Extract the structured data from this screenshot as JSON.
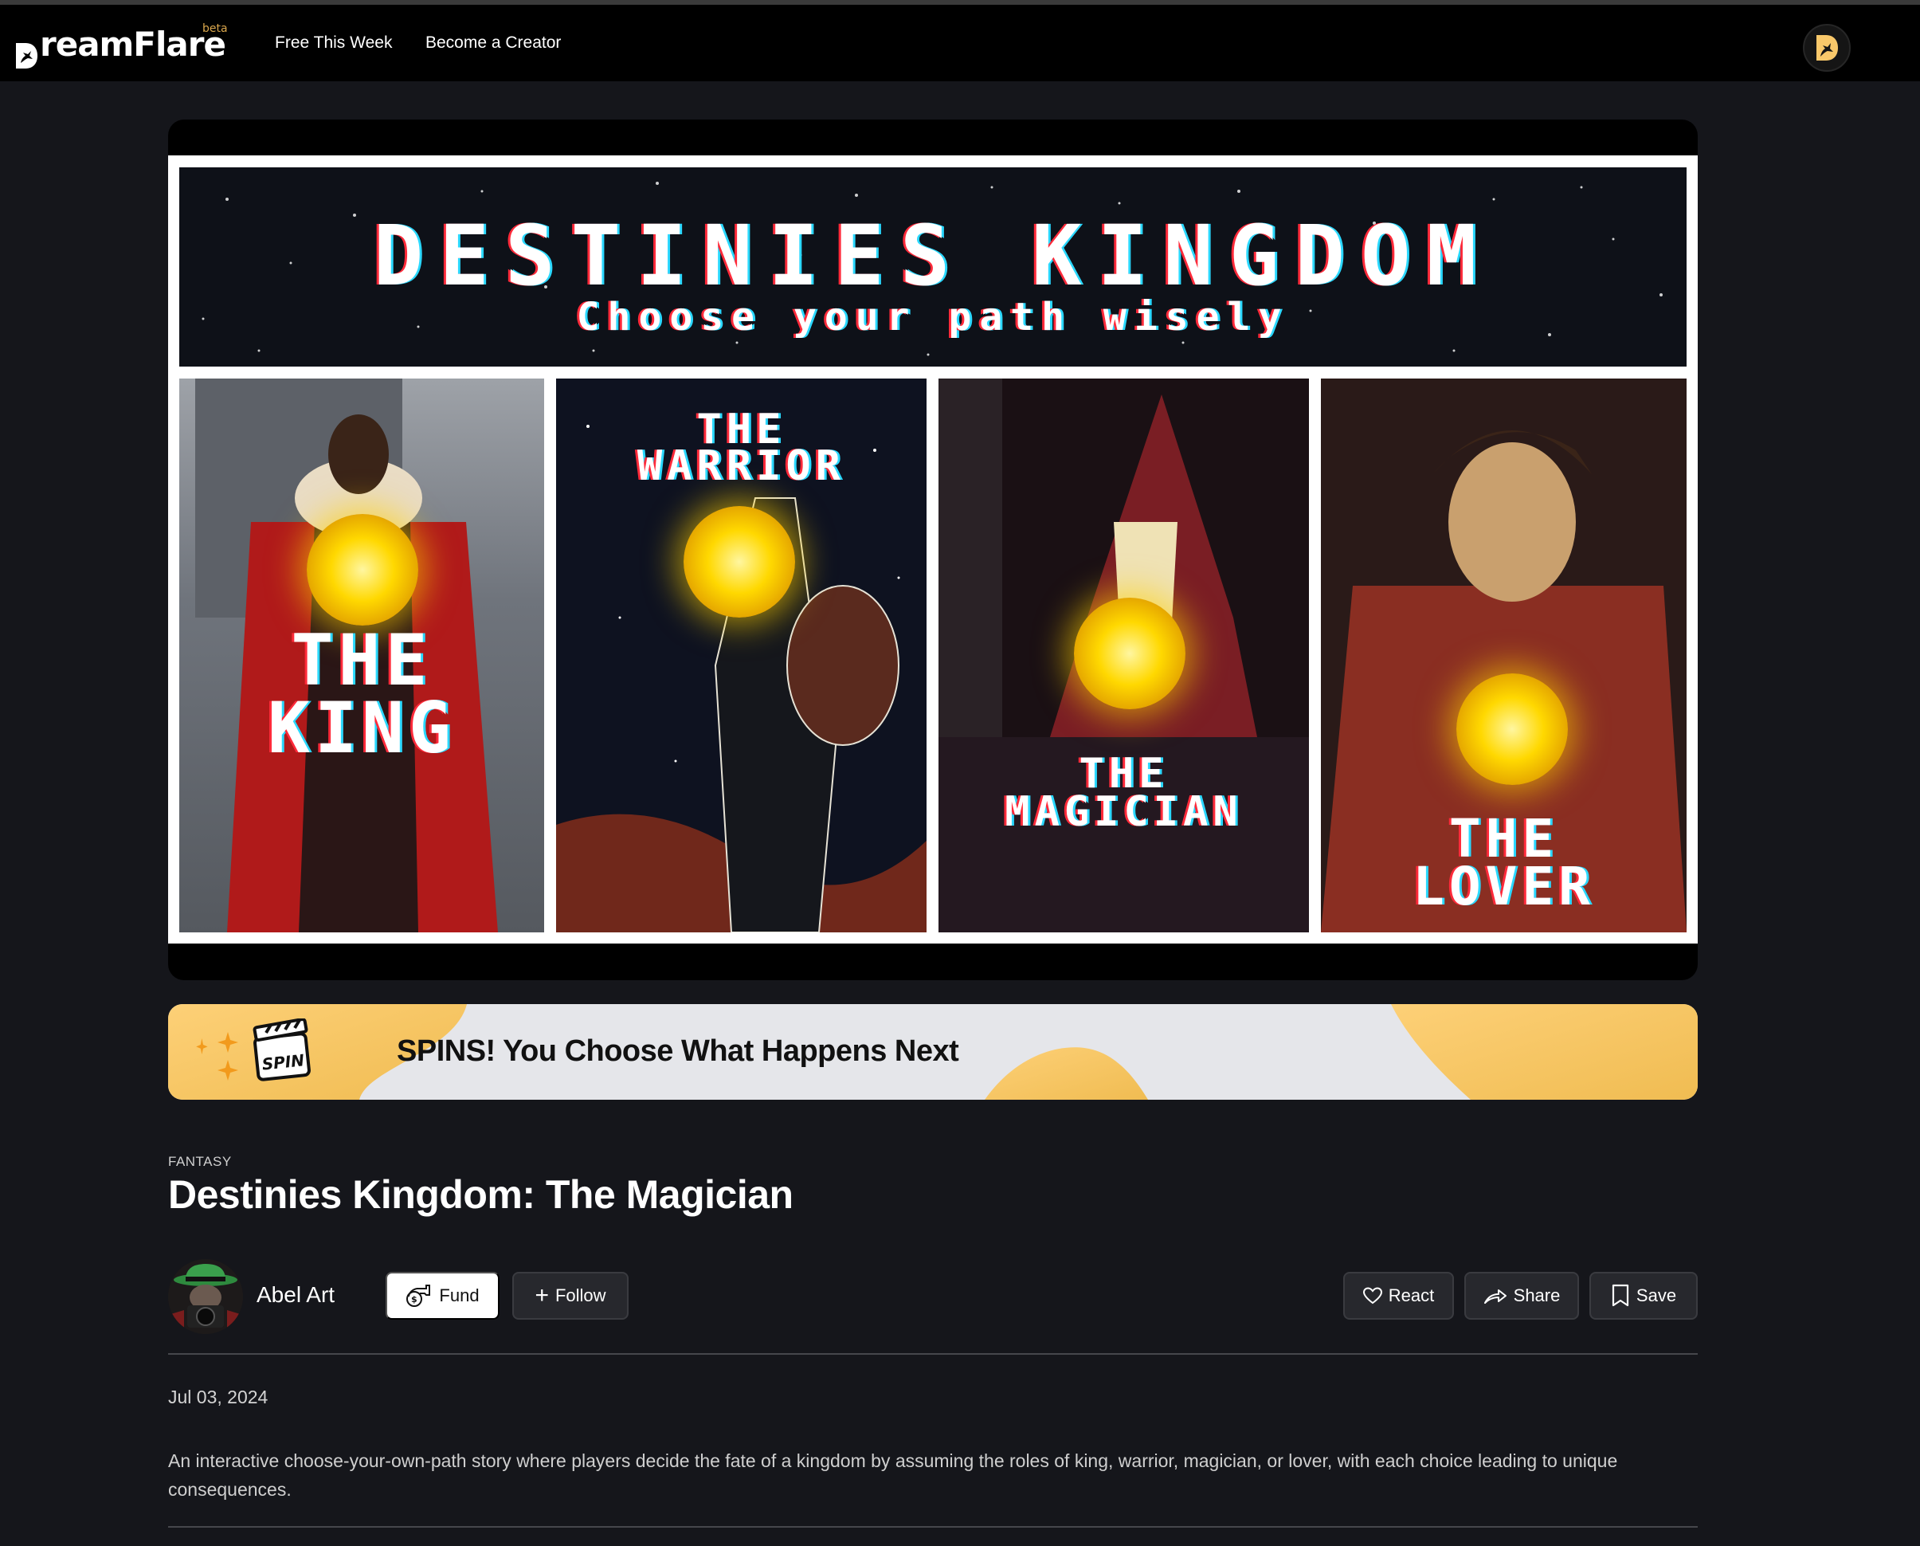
{
  "header": {
    "logo_text": "DreamFlare",
    "beta_label": "beta",
    "nav": [
      {
        "label": "Free This Week"
      },
      {
        "label": "Become a Creator"
      }
    ],
    "profile_icon": "dreamflare-mark-icon"
  },
  "hero": {
    "title": "DESTINIES KINGDOM",
    "subtitle": "Choose your path wisely",
    "panels": [
      {
        "line1": "THE",
        "line2": "KING"
      },
      {
        "line1": "THE",
        "line2": "WARRIOR"
      },
      {
        "line1": "THE",
        "line2": "MAGICIAN"
      },
      {
        "line1": "THE",
        "line2": "LOVER"
      }
    ]
  },
  "spin_banner": {
    "badge": "SPIN",
    "text": "SPINS! You Choose What Happens Next"
  },
  "story": {
    "genre": "FANTASY",
    "title": "Destinies Kingdom: The Magician",
    "author": "Abel Art",
    "date": "Jul 03, 2024",
    "description": "An interactive choose-your-own-path story where players decide the fate of a kingdom by assuming the roles of king, warrior, magician, or lover, with each choice leading to unique consequences."
  },
  "actions": {
    "fund": "Fund",
    "follow": "Follow",
    "react": "React",
    "share": "Share",
    "save": "Save"
  },
  "colors": {
    "accent": "#f5c25a",
    "beta": "#d9a64c",
    "background": "#15161b"
  }
}
